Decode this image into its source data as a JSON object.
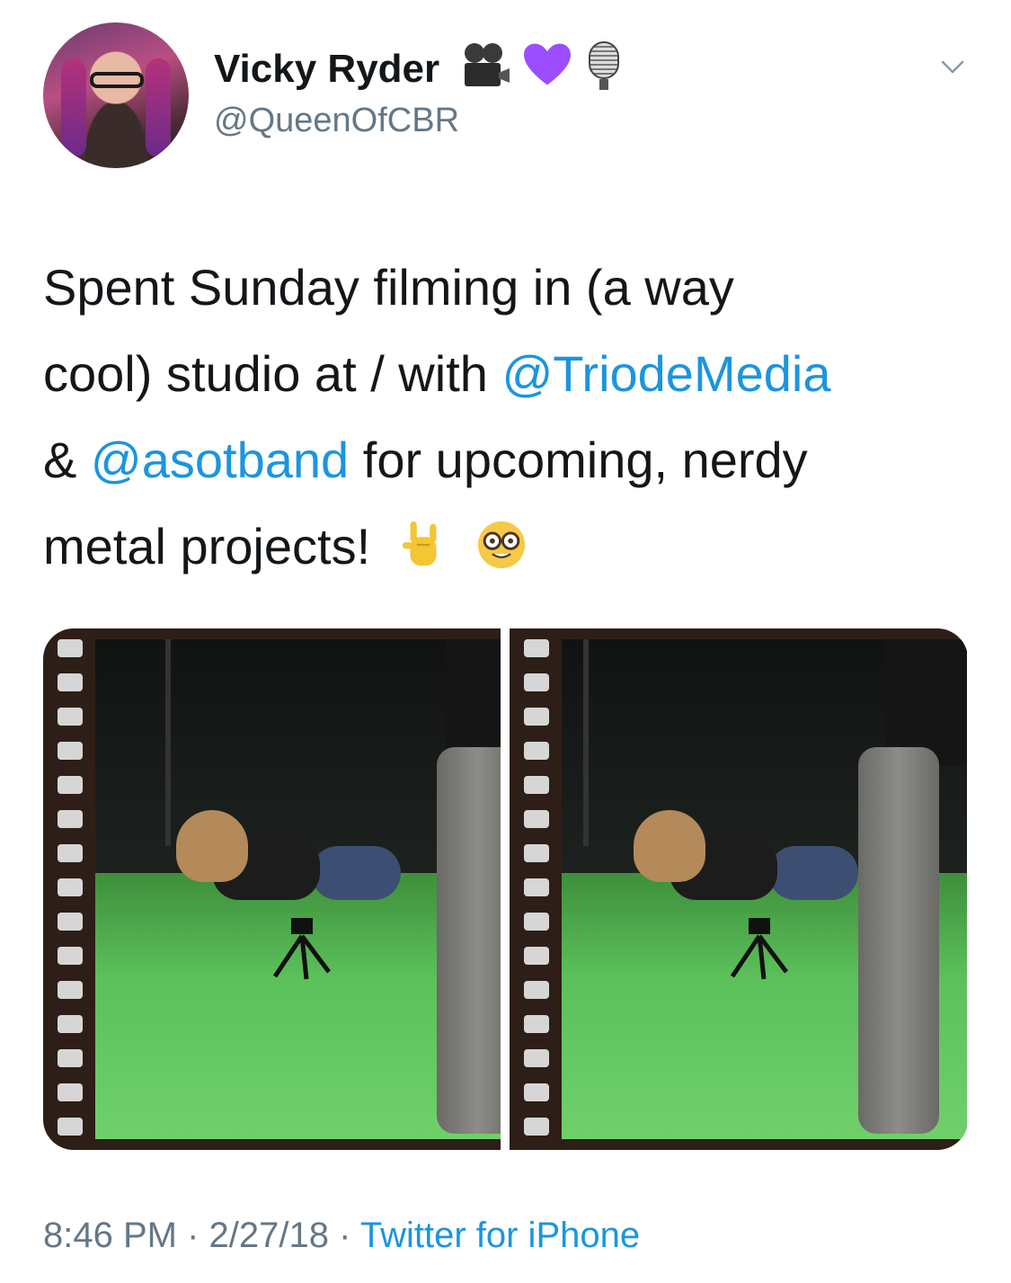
{
  "tweet": {
    "author": {
      "display_name": "Vicky Ryder",
      "handle": "@QueenOfCBR",
      "name_emoji_icons": [
        "movie-camera-icon",
        "purple-heart-icon",
        "studio-microphone-icon"
      ]
    },
    "text_lines": [
      {
        "plain": "Spent Sunday filming in (a way"
      },
      {
        "plain": "cool) studio at / with ",
        "mention": "@TriodeMedia"
      },
      {
        "pre": "& ",
        "mention": "@asotband",
        "post": " for upcoming, nerdy"
      },
      {
        "plain": "metal projects!",
        "emoji_icons": [
          "sign-of-the-horns-icon",
          "nerd-face-icon"
        ]
      }
    ],
    "media": [
      {
        "description_icon": "photo-green-screen-studio-1"
      },
      {
        "description_icon": "photo-green-screen-studio-2"
      }
    ],
    "time": "8:46 PM",
    "date": "2/27/18",
    "separator": "·",
    "source": "Twitter for iPhone"
  },
  "colors": {
    "link": "#1b95e0",
    "secondary_text": "#657786",
    "primary_text": "#14171a",
    "heart": "#9b4dff"
  }
}
